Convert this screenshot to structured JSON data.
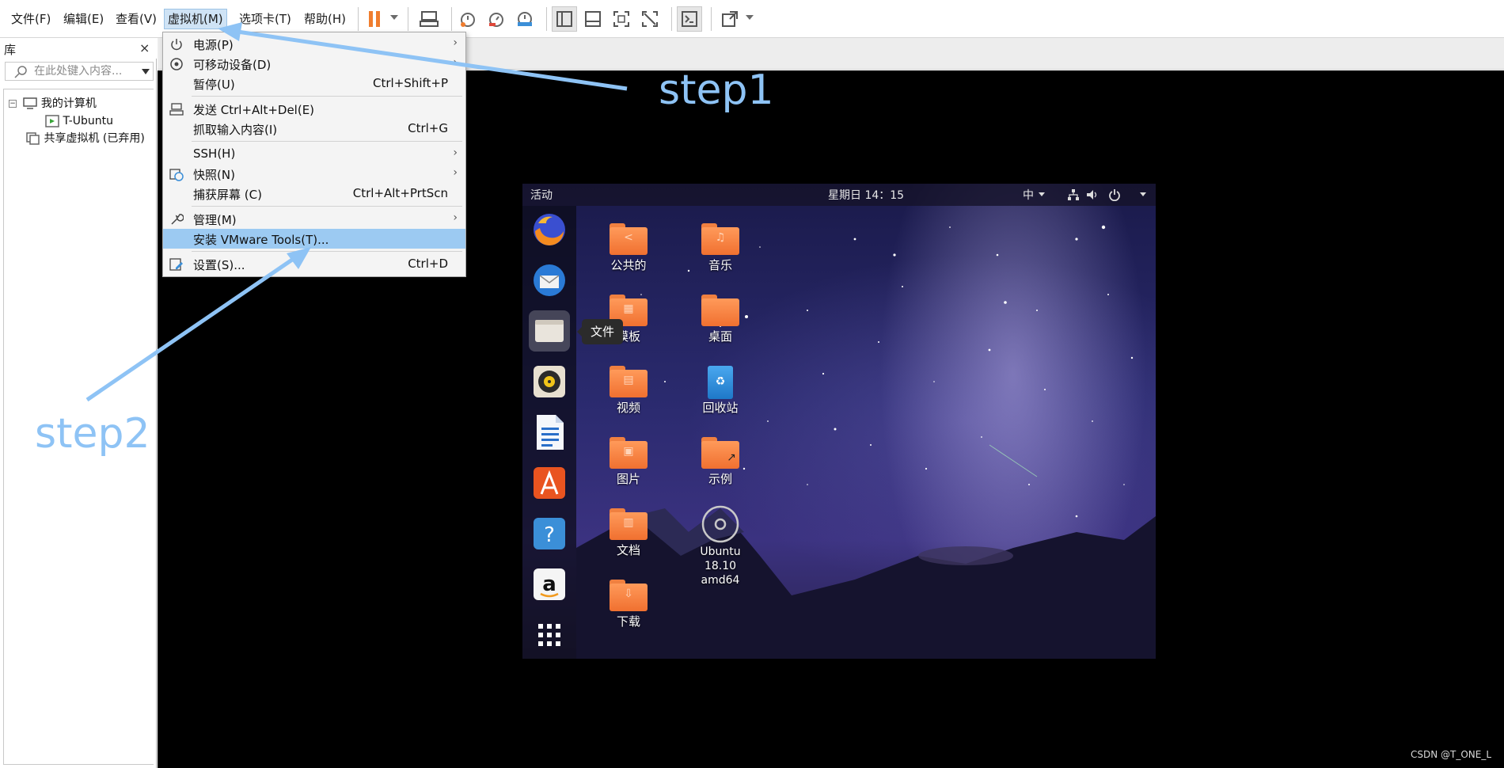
{
  "menubar": {
    "items": [
      {
        "label": "文件(F)"
      },
      {
        "label": "编辑(E)"
      },
      {
        "label": "查看(V)"
      },
      {
        "label": "虚拟机(M)"
      },
      {
        "label": "选项卡(T)"
      },
      {
        "label": "帮助(H)"
      }
    ]
  },
  "toolbar": {
    "icons": [
      "pause-icon",
      "send-ctrl-alt-del-icon",
      "snapshot-icon",
      "revert-snapshot-icon",
      "snapshot-manager-icon",
      "show-library-icon",
      "show-thumbnail-icon",
      "fullscreen-icon",
      "unity-icon",
      "console-icon",
      "stretch-icon"
    ]
  },
  "library": {
    "title": "库",
    "close": "×",
    "search_placeholder": "在此处键入内容...",
    "tree": [
      {
        "label": "我的计算机"
      },
      {
        "label": "T-Ubuntu"
      },
      {
        "label": "共享虚拟机 (已弃用)"
      }
    ]
  },
  "vm_menu": {
    "items": [
      {
        "label": "电源(P)",
        "accel": "",
        "submenu": true
      },
      {
        "label": "可移动设备(D)",
        "accel": "",
        "submenu": true
      },
      {
        "label": "暂停(U)",
        "accel": "Ctrl+Shift+P",
        "submenu": false
      },
      {
        "label": "发送 Ctrl+Alt+Del(E)",
        "accel": "",
        "submenu": false
      },
      {
        "label": "抓取输入内容(I)",
        "accel": "Ctrl+G",
        "submenu": false
      },
      {
        "label": "SSH(H)",
        "accel": "",
        "submenu": true
      },
      {
        "label": "快照(N)",
        "accel": "",
        "submenu": true
      },
      {
        "label": "捕获屏幕 (C)",
        "accel": "Ctrl+Alt+PrtScn",
        "submenu": false
      },
      {
        "label": "管理(M)",
        "accel": "",
        "submenu": true
      },
      {
        "label": "安装 VMware Tools(T)...",
        "accel": "",
        "submenu": false
      },
      {
        "label": "设置(S)...",
        "accel": "Ctrl+D",
        "submenu": false
      }
    ],
    "submenu_glyph": "›"
  },
  "ubuntu": {
    "topbar": {
      "activities": "活动",
      "clock": "星期日 14：15",
      "ime": "中"
    },
    "tooltip": "文件",
    "desktop_items": [
      {
        "label": "公共的",
        "glyph": "<"
      },
      {
        "label": "音乐",
        "glyph": "♫"
      },
      {
        "label": "模板",
        "glyph": "▦"
      },
      {
        "label": "桌面",
        "glyph": ""
      },
      {
        "label": "视频",
        "glyph": "▤"
      },
      {
        "label": "回收站",
        "glyph": "♻"
      },
      {
        "label": "图片",
        "glyph": "▣"
      },
      {
        "label": "示例",
        "glyph": "↗"
      },
      {
        "label": "文档",
        "glyph": "▥"
      },
      {
        "label": "Ubuntu 18.10 amd64",
        "glyph": ""
      },
      {
        "label": "下载",
        "glyph": "⇩"
      }
    ],
    "dock_help_glyph": "?",
    "dock_amazon_glyph": "a"
  },
  "annotations": {
    "step1": "step1",
    "step2": "step2"
  },
  "watermark": "CSDN @T_ONE_L",
  "colors": {
    "annotation": "#8ec3f5",
    "highlight": "#9ccaf2",
    "pause": "#f07d2e"
  }
}
